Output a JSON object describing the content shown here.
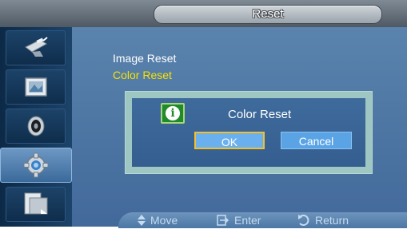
{
  "header": {
    "title": "Reset"
  },
  "sidebar": {
    "items": [
      {
        "icon": "satellite-dish-icon"
      },
      {
        "icon": "picture-frame-icon"
      },
      {
        "icon": "speaker-icon"
      },
      {
        "icon": "gear-icon",
        "active": true
      },
      {
        "icon": "panel-screen-icon"
      }
    ]
  },
  "menu": {
    "items": [
      {
        "label": "Image Reset",
        "state": "normal"
      },
      {
        "label": "Color Reset",
        "state": "selected"
      }
    ]
  },
  "dialog": {
    "icon": "info-icon",
    "title": "Color Reset",
    "buttons": {
      "ok": "OK",
      "cancel": "Cancel"
    }
  },
  "bottombar": {
    "move": "Move",
    "enter": "Enter",
    "return": "Return"
  },
  "colors": {
    "accent": "#f7e200",
    "main_bg": "#4f78a6",
    "sidebar_bg": "#143556",
    "ok_focus_border": "#f2c02d"
  }
}
